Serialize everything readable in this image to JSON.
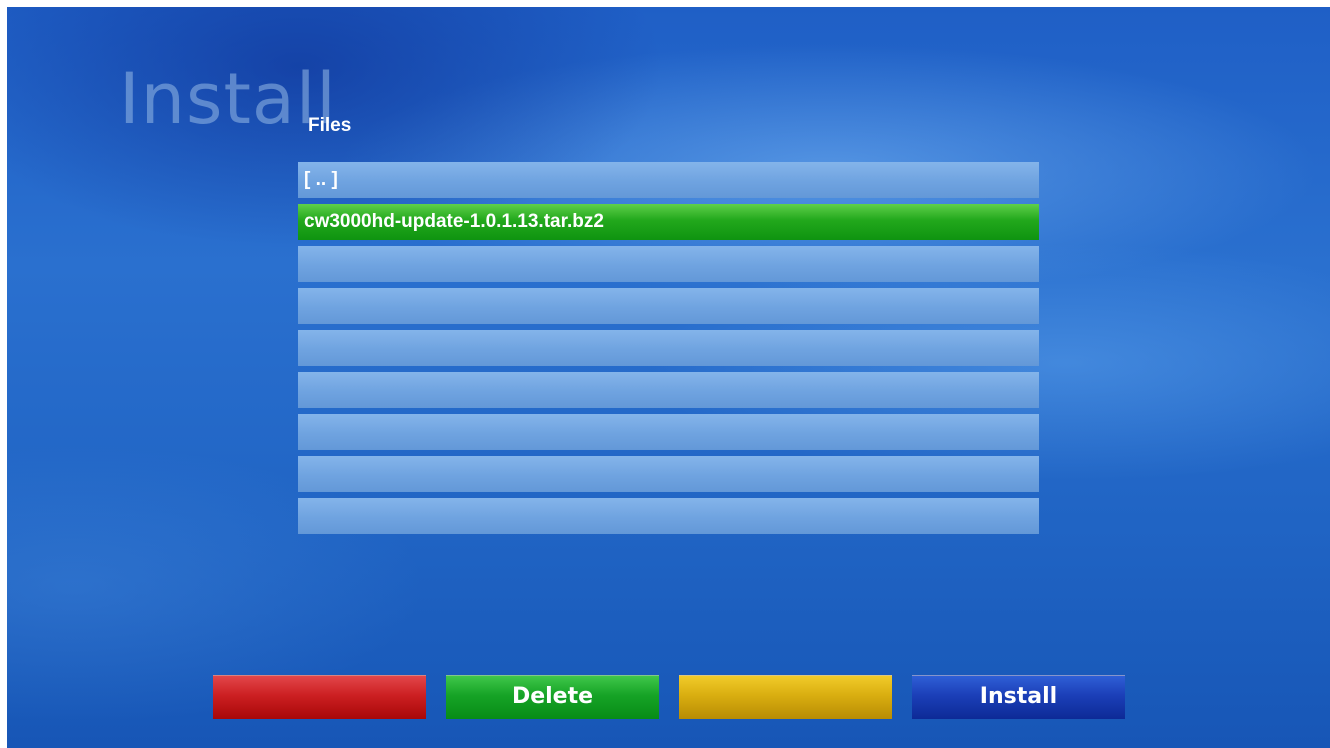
{
  "screen": {
    "title": "Install",
    "list_title": "Files"
  },
  "file_list": {
    "items": [
      {
        "label": "[ .. ]"
      },
      {
        "label": "cw3000hd-update-1.0.1.13.tar.bz2",
        "selected": true
      },
      {
        "label": ""
      },
      {
        "label": ""
      },
      {
        "label": ""
      },
      {
        "label": ""
      },
      {
        "label": ""
      },
      {
        "label": ""
      },
      {
        "label": ""
      }
    ]
  },
  "buttons": {
    "red_label": "",
    "green_label": "Delete",
    "yellow_label": "",
    "blue_label": "Install"
  },
  "colors": {
    "selection": "#16a326",
    "red_key": "#cc1f22",
    "green_key": "#16a326",
    "yellow_key": "#d9ae10",
    "blue_key": "#1b3fb8"
  }
}
